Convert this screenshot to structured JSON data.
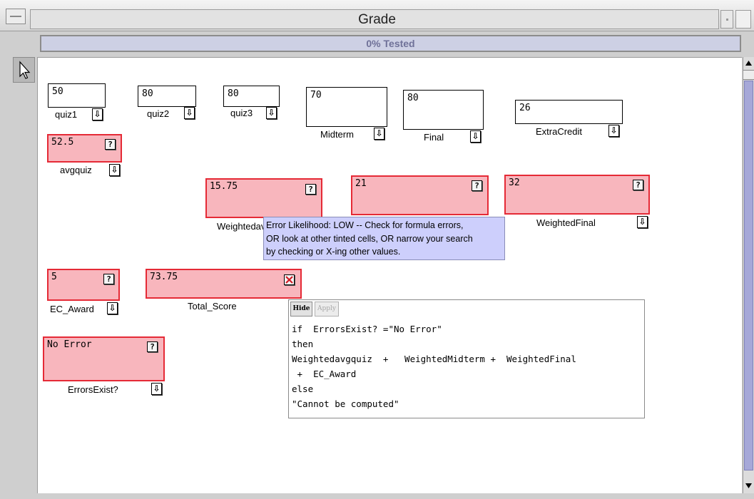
{
  "window": {
    "title": "Grade"
  },
  "status": {
    "text": "0% Tested"
  },
  "icons": {
    "menu": "window-menu-icon",
    "pointer": "pointer-arrow-icon",
    "question": "?",
    "arrow": "⇩",
    "x_mark": "x-mark-icon"
  },
  "colors": {
    "error_fill": "#f8b6bd",
    "error_border": "#e52a36",
    "tooltip_bg": "#cdcffc",
    "status_text": "#6f7198",
    "scroll_thumb": "#a6a8d8"
  },
  "cells": {
    "quiz1": {
      "value": "50",
      "label": "quiz1"
    },
    "quiz2": {
      "value": "80",
      "label": "quiz2"
    },
    "quiz3": {
      "value": "80",
      "label": "quiz3"
    },
    "midterm": {
      "value": "70",
      "label": "Midterm"
    },
    "final": {
      "value": "80",
      "label": "Final"
    },
    "extracredit": {
      "value": "26",
      "label": "ExtraCredit"
    },
    "avgquiz": {
      "value": "52.5",
      "label": "avgquiz"
    },
    "weightedavgquiz": {
      "value": "15.75",
      "label": "Weightedavgquiz"
    },
    "weightedmidterm": {
      "value": "21"
    },
    "weightedfinal": {
      "value": "32",
      "label": "WeightedFinal"
    },
    "ec_award": {
      "value": "5",
      "label": "EC_Award"
    },
    "total_score": {
      "value": "73.75",
      "label": "Total_Score"
    },
    "errorsexist": {
      "value": "No Error",
      "label": "ErrorsExist?"
    }
  },
  "tooltip": {
    "line1": "Error Likelihood: LOW -- Check for formula errors,",
    "line2": "OR look at other tinted cells, OR narrow your search",
    "line3": "by checking or X-ing other values."
  },
  "formula": {
    "hide_label": "Hide",
    "apply_label": "Apply",
    "text": "if  ErrorsExist? =\"No Error\"\nthen\nWeightedavgquiz  +   WeightedMidterm +  WeightedFinal\n +  EC_Award\nelse\n\"Cannot be computed\""
  }
}
